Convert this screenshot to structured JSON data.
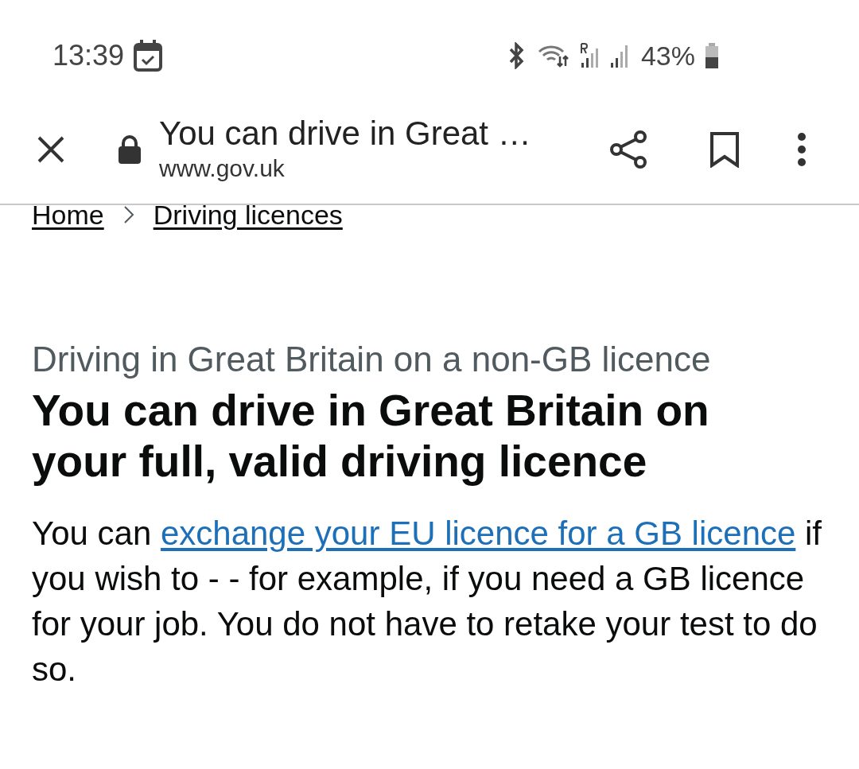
{
  "status_bar": {
    "time": "13:39",
    "battery": "43%"
  },
  "toolbar": {
    "title": "You can drive in Great …",
    "url": "www.gov.uk"
  },
  "breadcrumbs": [
    {
      "label": "Home"
    },
    {
      "label": "Driving licences"
    }
  ],
  "caption": "Driving in Great Britain on a non-GB licence",
  "heading": "You can drive in Great Britain on your full, valid driving licence",
  "paragraph": {
    "before": "You can ",
    "link": "exchange your EU licence for a GB licence",
    "after": " if you wish to - - for example, if you need a GB licence for your job. You do not have to retake your test to do so."
  }
}
